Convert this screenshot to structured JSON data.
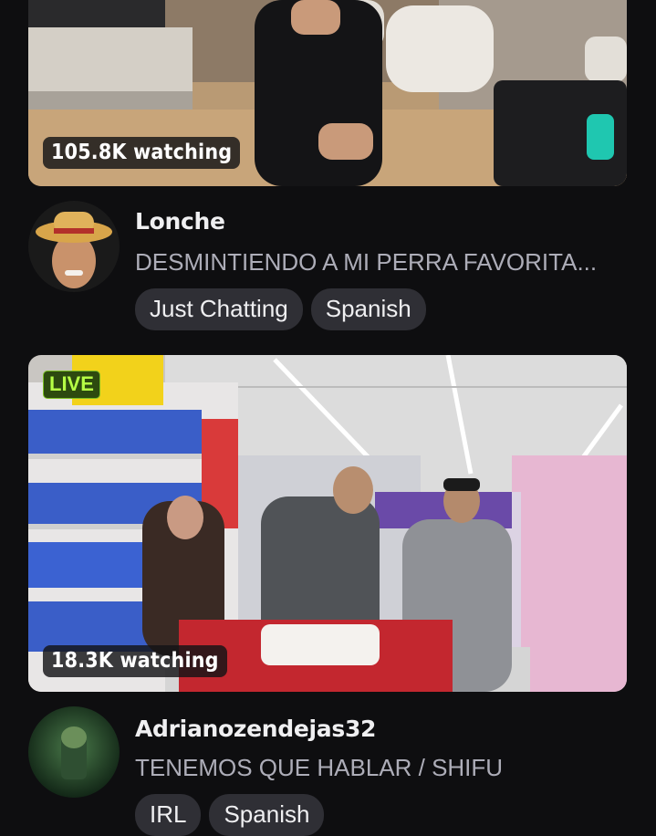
{
  "streams": [
    {
      "viewers": "105.8K watching",
      "channel": "Lonche",
      "title": "DESMINTIENDO A MI PERRA FAVORITA...",
      "tags": [
        "Just Chatting",
        "Spanish"
      ]
    },
    {
      "live_badge": "LIVE",
      "viewers": "18.3K watching",
      "channel": "Adrianozendejas32",
      "title": "TENEMOS QUE HABLAR / SHIFU",
      "tags": [
        "IRL",
        "Spanish"
      ]
    }
  ],
  "colors": {
    "background": "#0e0e10",
    "tag_background": "#2f2f35",
    "live_green": "#b6ff45"
  }
}
